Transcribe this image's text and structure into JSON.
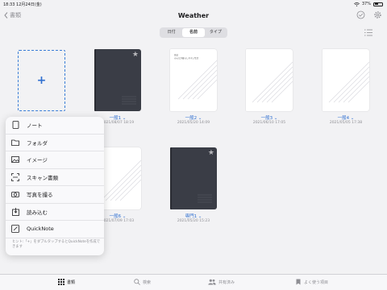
{
  "status": {
    "time": "18:33",
    "date": "12月24日(金)",
    "battery": "37%"
  },
  "nav": {
    "back_label": "書類",
    "title": "Weather"
  },
  "sort": {
    "options": [
      "日付",
      "名前",
      "タイプ"
    ],
    "active_index": 1
  },
  "new_tile": {
    "icon": "plus-icon"
  },
  "documents": [
    {
      "name": "一般1",
      "date": "2021/08/07 18:19",
      "cover": "dark",
      "starred": true
    },
    {
      "name": "一般2",
      "date": "2021/05/20 14:09",
      "cover": "light",
      "cover_text": [
        "日誌",
        "みんなが暮らしやすい生活"
      ],
      "starred": false
    },
    {
      "name": "一般3",
      "date": "2021/06/10 17:05",
      "cover": "light",
      "starred": false
    },
    {
      "name": "一般4",
      "date": "2021/05/05 17:38",
      "cover": "light",
      "starred": false
    },
    {
      "name": "一般6",
      "date": "2021/07/09 17:03",
      "cover": "light",
      "starred": false
    },
    {
      "name": "専門1",
      "date": "2021/05/20 15:23",
      "cover": "dark",
      "starred": true
    }
  ],
  "menu": {
    "items": [
      {
        "label": "ノート",
        "icon": "tablet-icon"
      },
      {
        "label": "フォルダ",
        "icon": "folder-icon"
      },
      {
        "label": "イメージ",
        "icon": "image-icon"
      },
      {
        "label": "スキャン書類",
        "icon": "scan-icon"
      },
      {
        "label": "写真を撮る",
        "icon": "camera-icon"
      },
      {
        "label": "読み込む",
        "icon": "import-icon"
      },
      {
        "label": "QuickNote",
        "icon": "quicknote-icon"
      }
    ],
    "hint": "ヒント:「+」をダブルタップするとQuickNoteを作成できます"
  },
  "tabbar": {
    "items": [
      {
        "label": "書類",
        "icon": "grid-icon",
        "active": true
      },
      {
        "label": "検索",
        "icon": "search-icon",
        "active": false
      },
      {
        "label": "共有済み",
        "icon": "people-icon",
        "active": false
      },
      {
        "label": "よく使う項目",
        "icon": "bookmark-icon",
        "active": false
      }
    ]
  },
  "colors": {
    "accent": "#2f6fd0",
    "background": "#f2f2f4",
    "dark_cover": "#3a3d46"
  }
}
